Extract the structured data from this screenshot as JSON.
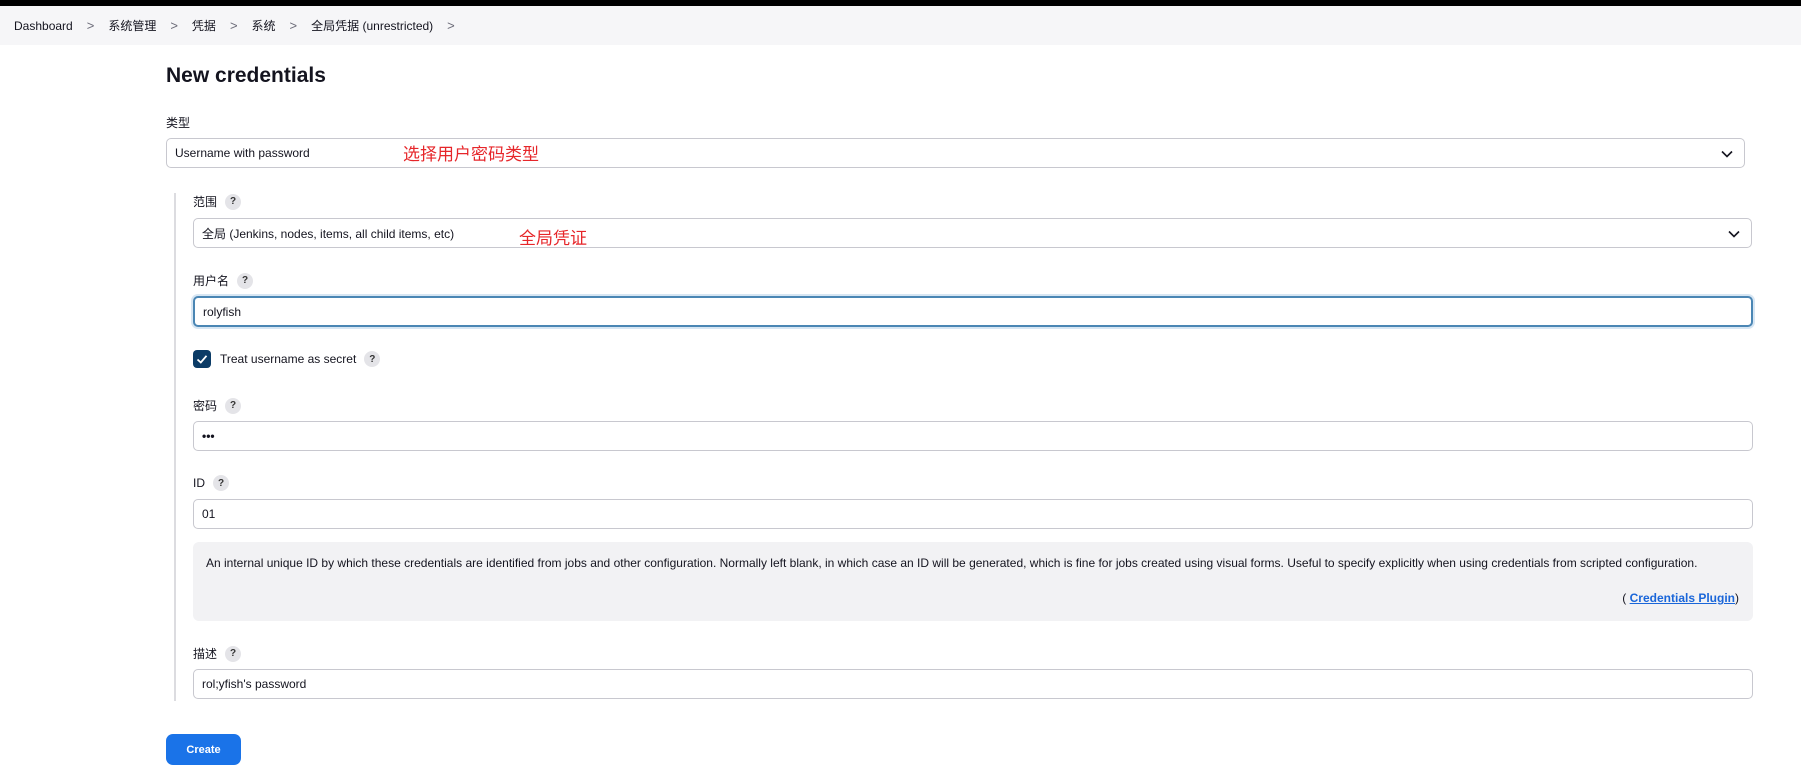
{
  "breadcrumbs": [
    "Dashboard",
    "系统管理",
    "凭据",
    "系统",
    "全局凭据 (unrestricted)"
  ],
  "page_title": "New credentials",
  "kind": {
    "label": "类型",
    "value": "Username with password",
    "annotation": "选择用户密码类型"
  },
  "scope": {
    "label": "范围",
    "value": "全局 (Jenkins, nodes, items, all child items, etc)",
    "annotation": "全局凭证"
  },
  "username": {
    "label": "用户名",
    "value": "rolyfish"
  },
  "treat_secret": {
    "label": "Treat username as secret",
    "checked": true
  },
  "password": {
    "label": "密码",
    "value": "•••"
  },
  "id": {
    "label": "ID",
    "value": "01",
    "help_text": "An internal unique ID by which these credentials are identified from jobs and other configuration. Normally left blank, in which case an ID will be generated, which is fine for jobs created using visual forms. Useful to specify explicitly when using credentials from scripted configuration.",
    "plugin_open": "(",
    "plugin_link": "Credentials Plugin",
    "plugin_close": ")"
  },
  "description": {
    "label": "描述",
    "value": "rol;yfish's password"
  },
  "help_glyph": "?",
  "create_label": "Create",
  "colors": {
    "primary": "#1a73e8",
    "checkbox": "#0b3b66",
    "annotation": "#e6262a",
    "focus_border": "#4b86b4"
  }
}
